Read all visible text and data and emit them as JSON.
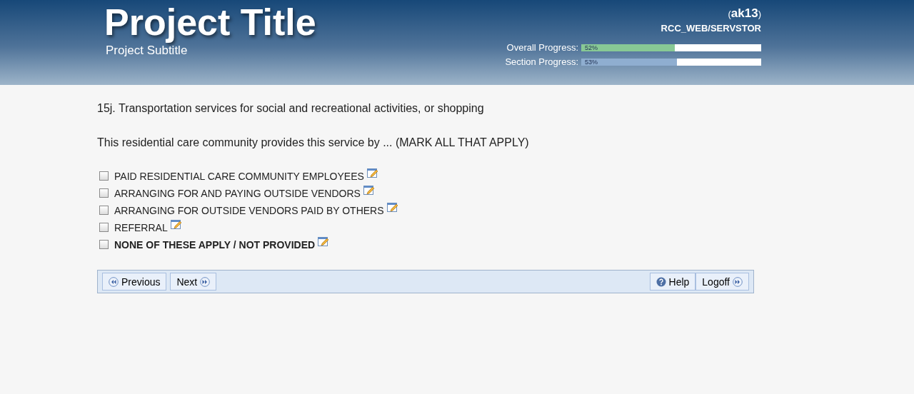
{
  "header": {
    "title": "Project Title",
    "subtitle": "Project Subtitle",
    "user": "(**ak13**)",
    "server": "RCC_WEB/SERVSTOR",
    "progress": [
      {
        "label": "Overall Progress:",
        "reading": "52%",
        "level": 0.52,
        "color": "#88c995"
      },
      {
        "label": "Section Progress:",
        "reading": "53%",
        "level": 0.53,
        "color": "#8faed0"
      }
    ]
  },
  "question": {
    "title": "15j. Transportation services for social and recreational activities, or shopping",
    "prompt": "This residential care community provides this service by ... (MARK ALL THAT APPLY)",
    "options": [
      {
        "label": "PAID RESIDENTIAL CARE COMMUNITY EMPLOYEES",
        "checked": false,
        "kind": "option"
      },
      {
        "label": "ARRANGING FOR AND PAYING OUTSIDE VENDORS",
        "checked": false,
        "kind": "option"
      },
      {
        "label": "ARRANGING FOR OUTSIDE VENDORS PAID BY OTHERS",
        "checked": false,
        "kind": "option"
      },
      {
        "label": "REFERRAL",
        "checked": false,
        "kind": "option"
      },
      {
        "label": "NONE OF THESE APPLY / NOT PROVIDED",
        "checked": false,
        "kind": "exclusive"
      }
    ]
  },
  "nav": {
    "left": [
      {
        "label": "Previous",
        "kind": "previous"
      },
      {
        "label": "Next",
        "kind": "next"
      }
    ],
    "right": [
      {
        "label": "Help",
        "kind": "help"
      },
      {
        "label": "Logoff",
        "kind": "next"
      }
    ]
  }
}
